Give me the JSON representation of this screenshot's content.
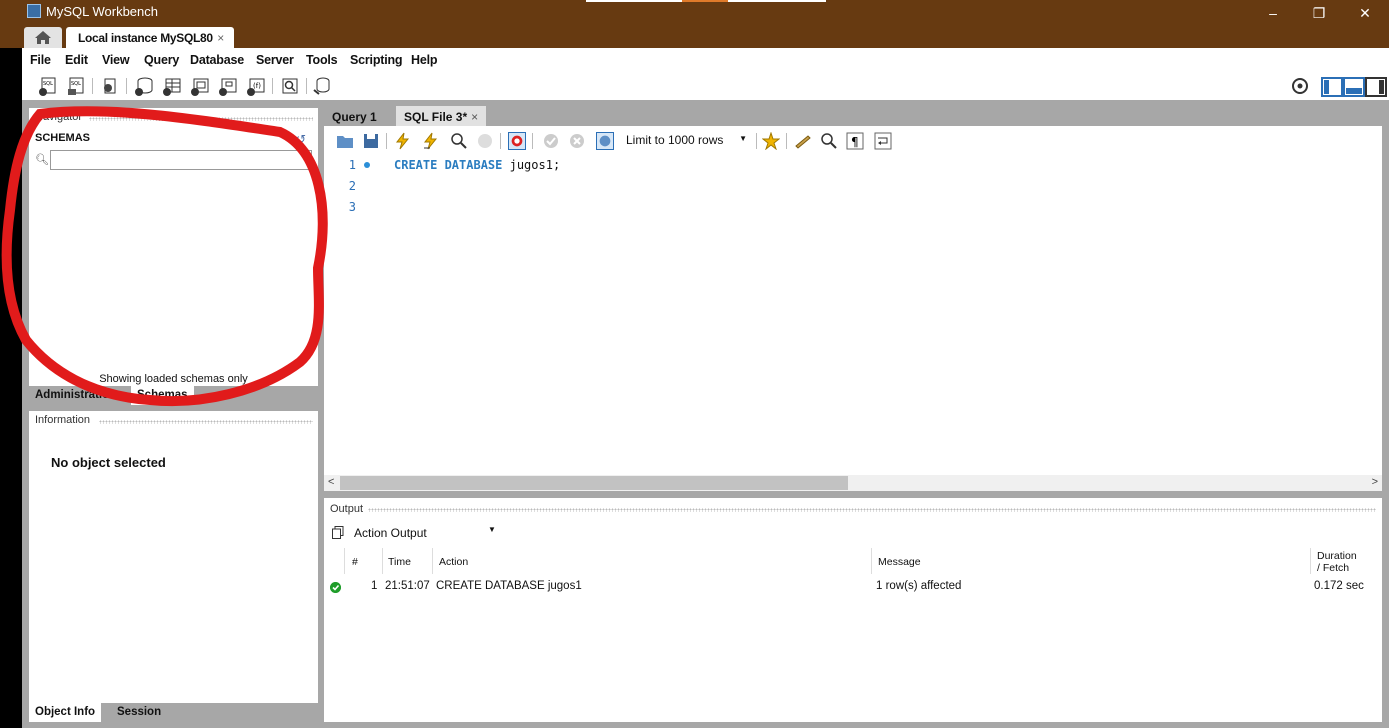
{
  "window": {
    "title": "MySQL Workbench"
  },
  "tabs": {
    "connection_tab": "Local instance MySQL80",
    "close_glyph": "×"
  },
  "menu": [
    "File",
    "Edit",
    "View",
    "Query",
    "Database",
    "Server",
    "Tools",
    "Scripting",
    "Help"
  ],
  "navigator": {
    "header": "Navigator",
    "schemas_title": "SCHEMAS",
    "search_placeholder": "",
    "footer_note": "Showing loaded schemas only",
    "tabs": [
      "Administration",
      "Schemas"
    ],
    "active_tab": "Schemas"
  },
  "information": {
    "header": "Information",
    "message": "No object selected",
    "tabs": [
      "Object Info",
      "Session"
    ]
  },
  "editor": {
    "tabs": [
      "Query 1",
      "SQL File 3*"
    ],
    "active_tab": "SQL File 3*",
    "limit_select": "Limit to 1000 rows",
    "lines": [
      {
        "number": "1",
        "marker": true,
        "keyword": "CREATE DATABASE",
        "text": " jugos1;"
      },
      {
        "number": "2",
        "marker": false,
        "keyword": "",
        "text": ""
      },
      {
        "number": "3",
        "marker": false,
        "keyword": "",
        "text": ""
      }
    ]
  },
  "output": {
    "header": "Output",
    "selector": "Action Output",
    "columns": {
      "num": "#",
      "time": "Time",
      "action": "Action",
      "message": "Message",
      "duration_1": "Duration",
      "duration_2": "/ Fetch"
    },
    "rows": [
      {
        "status": "success",
        "num": "1",
        "time": "21:51:07",
        "action": "CREATE DATABASE jugos1",
        "message": "1 row(s) affected",
        "duration": "0.172 sec"
      }
    ]
  },
  "colors": {
    "titlebar": "#673a11",
    "background": "#a7a7a7",
    "keyword": "#2b7dc0",
    "success": "#1f9d2a",
    "annotation": "#e11b1b"
  }
}
